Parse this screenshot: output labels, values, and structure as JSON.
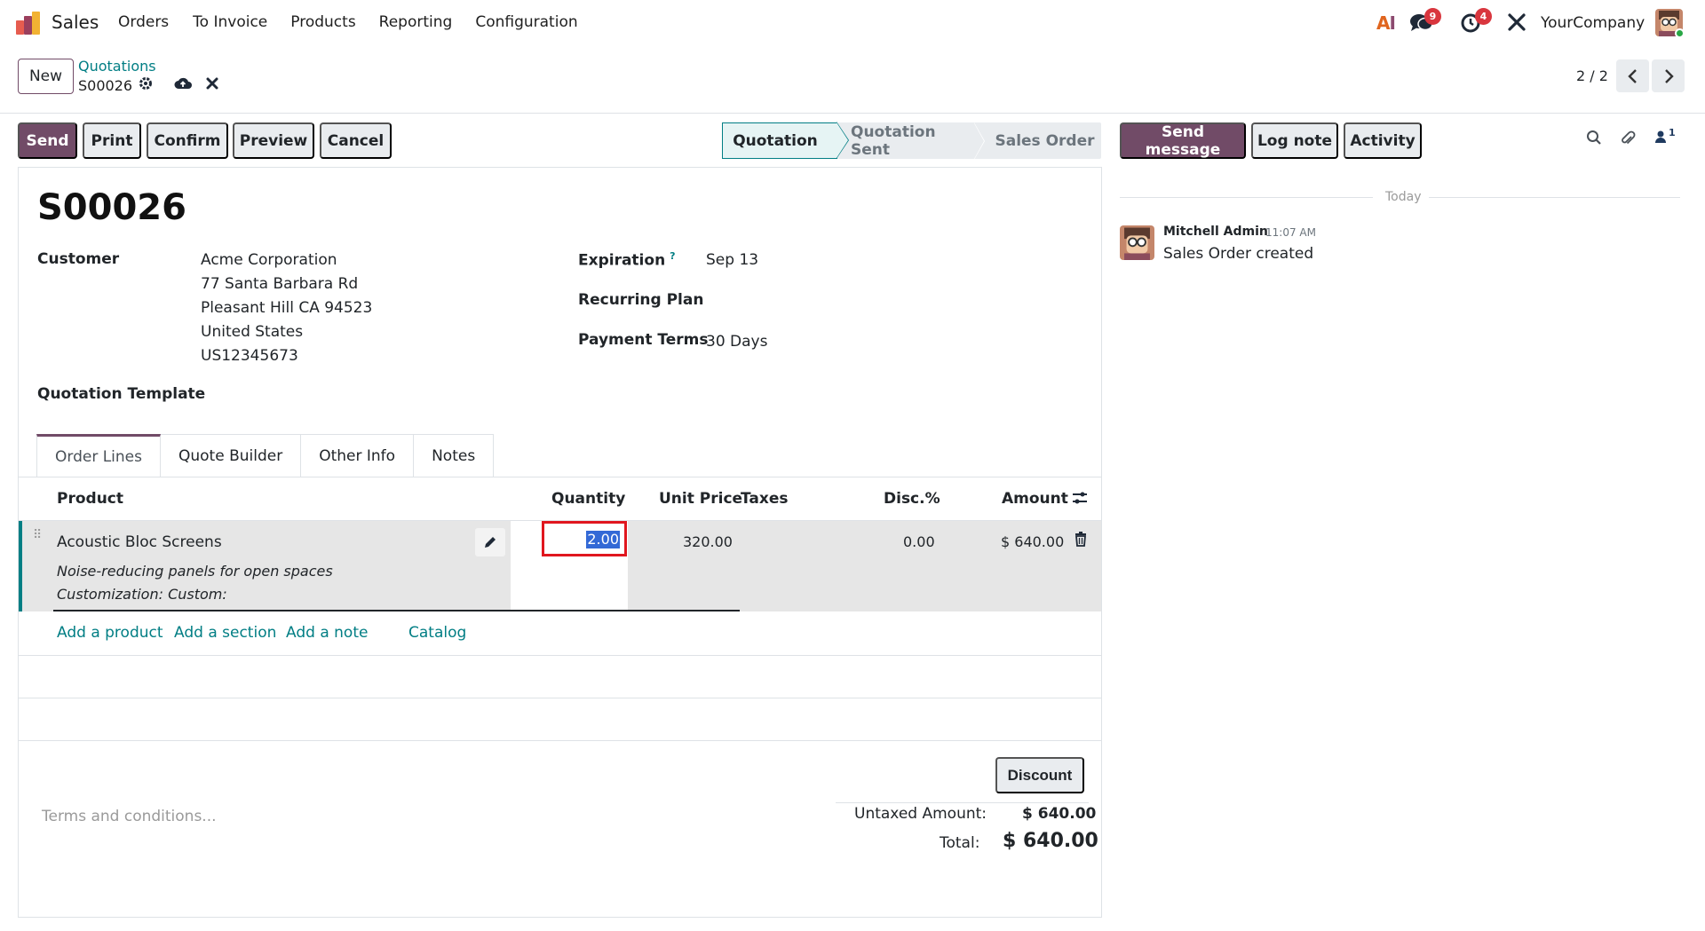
{
  "nav": {
    "app_name": "Sales",
    "menu": [
      "Orders",
      "To Invoice",
      "Products",
      "Reporting",
      "Configuration"
    ],
    "ai_label_a": "A",
    "ai_label_i": "I",
    "messages_badge": "9",
    "activities_badge": "4",
    "company": "YourCompany"
  },
  "control_panel": {
    "new_label": "New",
    "breadcrumb_parent": "Quotations",
    "breadcrumb_current": "S00026",
    "pager": "2 / 2"
  },
  "actions": {
    "send": "Send",
    "print": "Print",
    "confirm": "Confirm",
    "preview": "Preview",
    "cancel": "Cancel"
  },
  "stages": {
    "items": [
      "Quotation",
      "Quotation Sent",
      "Sales Order"
    ],
    "active": "Quotation"
  },
  "form": {
    "name": "S00026",
    "customer_label": "Customer",
    "customer_lines": [
      "Acme Corporation",
      "77 Santa Barbara Rd",
      "Pleasant Hill CA 94523",
      "United States",
      "US12345673"
    ],
    "quotation_template_label": "Quotation Template",
    "expiration_label": "Expiration",
    "expiration_help": "?",
    "expiration_value": "Sep 13",
    "recurring_plan_label": "Recurring Plan",
    "payment_terms_label": "Payment Terms",
    "payment_terms_value": "30 Days"
  },
  "tabs": [
    "Order Lines",
    "Quote Builder",
    "Other Info",
    "Notes"
  ],
  "table": {
    "headers": {
      "product": "Product",
      "quantity": "Quantity",
      "unit_price": "Unit Price",
      "taxes": "Taxes",
      "discount": "Disc.%",
      "amount": "Amount"
    },
    "rows": [
      {
        "product": "Acoustic Bloc Screens",
        "description_1": "Noise-reducing panels for open spaces",
        "description_2": "Customization: Custom:",
        "quantity": "2.00",
        "unit_price": "320.00",
        "taxes": "",
        "discount": "0.00",
        "amount": "$ 640.00"
      }
    ],
    "add_product": "Add a product",
    "add_section": "Add a section",
    "add_note": "Add a note",
    "catalog": "Catalog"
  },
  "footer": {
    "discount_button": "Discount",
    "terms_placeholder": "Terms and conditions...",
    "untaxed_label": "Untaxed Amount:",
    "untaxed_value": "$ 640.00",
    "total_label": "Total:",
    "total_value": "$ 640.00"
  },
  "chatter": {
    "send_message": "Send message",
    "log_note": "Log note",
    "activity": "Activity",
    "followers_count": "1",
    "today": "Today",
    "author": "Mitchell Admin",
    "time": "11:07 AM",
    "body": "Sales Order created"
  },
  "colors": {
    "brand": "#714b67",
    "link": "#017e84",
    "highlight_border": "#e0161e",
    "badge": "#d9363e"
  }
}
